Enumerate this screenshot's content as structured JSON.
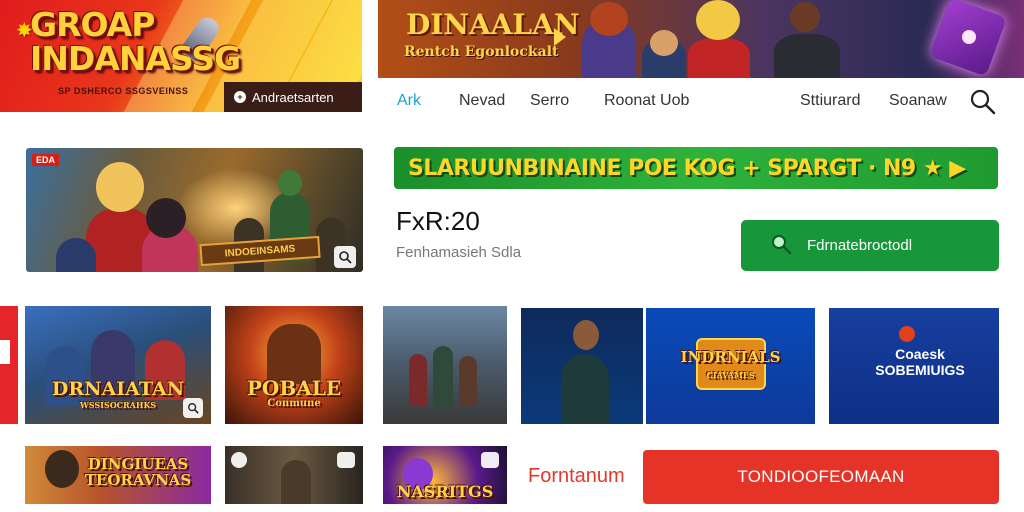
{
  "brand": {
    "logo_text": "GROAP INDANASSG",
    "logo_tagline": "SP DSHERCO SSGSVEINSS",
    "banner_button": "Andraetsarten",
    "banner_button_icon": "plus-icon"
  },
  "hero": {
    "title": "DINAALAN",
    "subtitle": "Rentch Egonlockalt"
  },
  "nav": {
    "items": [
      "Ark",
      "Nevad",
      "Serro",
      "Roonat Uob",
      "Sttiurard",
      "Soanaw"
    ],
    "active_index": 0,
    "active_color": "#1aa0d8",
    "search_icon": "search-icon"
  },
  "featured": {
    "badge": "EDA",
    "plaque": "INDOEINSAMS"
  },
  "promo": {
    "text": "SLARUUNBINAINE POE KOG + SPARGT · N9 ★ ▶",
    "color": "#2fb23c"
  },
  "listing": {
    "price": "FxR:20",
    "subtitle": "Fenhamasieh Sdla"
  },
  "actions": {
    "primary_button": "Fdrnatebroctodl",
    "primary_color": "#17963a",
    "cta_label": "Forntanum",
    "cta_button": "TONDIOOFEOMAAN",
    "cta_color": "#e63328"
  },
  "tiles": [
    {
      "label": "DRNAIATAN",
      "sub": "WSSISOCRAHKS"
    },
    {
      "label": "POBALE",
      "sub": "Conmune"
    },
    {
      "label": ""
    },
    {
      "label": ""
    },
    {
      "label": "INDRNIALS",
      "sub": "CIAVAMES"
    },
    {
      "label": "Coaesk SOBEMIUIGS"
    },
    {
      "label": "DINGIUEAS TEORAVNAS"
    },
    {
      "label": ""
    },
    {
      "label": "NASRITGS"
    }
  ]
}
